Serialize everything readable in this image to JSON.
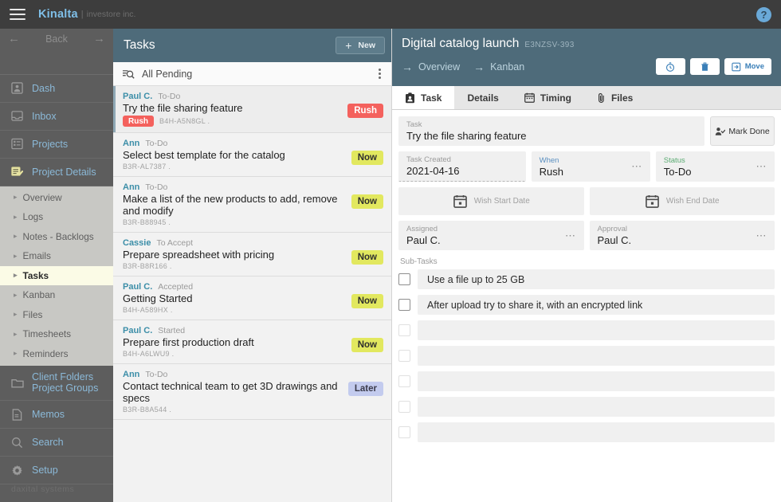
{
  "topbar": {
    "menu_icon": "hamburger-icon",
    "brand": "Kinalta",
    "separator": "|",
    "company": "investore inc.",
    "help_icon": "?"
  },
  "sidebar": {
    "back_label": "Back",
    "back_icon_left": "arrow-left-icon",
    "back_icon_right": "arrow-right-icon",
    "items": [
      {
        "label": "Dash",
        "icon": "dashboard-icon"
      },
      {
        "label": "Inbox",
        "icon": "inbox-icon"
      },
      {
        "label": "Projects",
        "icon": "projects-list-icon"
      },
      {
        "label": "Project Details",
        "icon": "project-details-icon"
      }
    ],
    "sub_items": [
      {
        "label": "Overview"
      },
      {
        "label": "Logs"
      },
      {
        "label": "Notes - Backlogs"
      },
      {
        "label": "Emails"
      },
      {
        "label": "Tasks"
      },
      {
        "label": "Kanban"
      },
      {
        "label": "Files"
      },
      {
        "label": "Timesheets"
      },
      {
        "label": "Reminders"
      }
    ],
    "selected_sub": "Tasks",
    "bottom_items": [
      {
        "label_line1": "Client Folders",
        "label_line2": "Project Groups",
        "icon": "folder-icon"
      },
      {
        "label_line1": "Memos",
        "label_line2": "",
        "icon": "document-icon"
      },
      {
        "label_line1": "Search",
        "label_line2": "",
        "icon": "search-icon"
      },
      {
        "label_line1": "Setup",
        "label_line2": "",
        "icon": "gear-icon"
      }
    ],
    "footer": "daxital systems"
  },
  "list_panel": {
    "title": "Tasks",
    "new_button": "New",
    "new_icon": "plus-icon",
    "filter_label": "All Pending",
    "filter_icon": "filter-search-icon",
    "menu_icon": "kebab-menu-icon",
    "tasks": [
      {
        "user": "Paul C.",
        "state": "To-Do",
        "title": "Try the file sharing feature",
        "inline_tag": "Rush",
        "id": "B4H-A5N8GL .",
        "badge": "Rush",
        "badge_kind": "rush",
        "selected": true
      },
      {
        "user": "Ann",
        "state": "To-Do",
        "title": "Select best template for the catalog",
        "inline_tag": "",
        "id": "B3R-AL7387 .",
        "badge": "Now",
        "badge_kind": "now",
        "selected": false
      },
      {
        "user": "Ann",
        "state": "To-Do",
        "title": "Make a list of the new products to add, remove and modify",
        "inline_tag": "",
        "id": "B3R-B88945 .",
        "badge": "Now",
        "badge_kind": "now",
        "selected": false
      },
      {
        "user": "Cassie",
        "state": "To Accept",
        "title": "Prepare spreadsheet with pricing",
        "inline_tag": "",
        "id": "B3R-B8R166 .",
        "badge": "Now",
        "badge_kind": "now",
        "selected": false
      },
      {
        "user": "Paul C.",
        "state": "Accepted",
        "title": "Getting Started",
        "inline_tag": "",
        "id": "B4H-A589HX .",
        "badge": "Now",
        "badge_kind": "now",
        "selected": false
      },
      {
        "user": "Paul C.",
        "state": "Started",
        "title": "Prepare first production draft",
        "inline_tag": "",
        "id": "B4H-A6LWU9 .",
        "badge": "Now",
        "badge_kind": "now",
        "selected": false
      },
      {
        "user": "Ann",
        "state": "To-Do",
        "title": "Contact technical team to get 3D drawings and specs",
        "inline_tag": "",
        "id": "B3R-B8A544 .",
        "badge": "Later",
        "badge_kind": "later",
        "selected": false
      }
    ]
  },
  "detail": {
    "project_title": "Digital catalog launch",
    "project_code": "E3NZSV-393",
    "links": [
      {
        "label": "Overview",
        "icon": "arrow-right-icon"
      },
      {
        "label": "Kanban",
        "icon": "arrow-right-icon"
      }
    ],
    "actions": [
      {
        "label": "",
        "icon": "timer-icon"
      },
      {
        "label": "",
        "icon": "trash-icon"
      },
      {
        "label": "Move",
        "icon": "move-icon"
      }
    ],
    "tabs": [
      {
        "label": "Task",
        "icon": "task-badge-icon",
        "active": true
      },
      {
        "label": "Details",
        "icon": "",
        "active": false
      },
      {
        "label": "Timing",
        "icon": "calendar-icon",
        "active": false
      },
      {
        "label": "Files",
        "icon": "paperclip-icon",
        "active": false
      }
    ],
    "mark_done": "Mark Done",
    "mark_done_icon": "person-check-icon",
    "fields": {
      "task_label": "Task",
      "task_value": "Try the file sharing feature",
      "created_label": "Task Created",
      "created_value": "2021-04-16",
      "when_label": "When",
      "when_value": "Rush",
      "status_label": "Status",
      "status_value": "To-Do",
      "wish_start_label": "Wish Start Date",
      "wish_start_value": "",
      "wish_end_label": "Wish End Date",
      "wish_end_value": "",
      "assigned_label": "Assigned",
      "assigned_value": "Paul C.",
      "approval_label": "Approval",
      "approval_value": "Paul C."
    },
    "subtasks_label": "Sub-Tasks",
    "subtasks": [
      {
        "text": "Use a file up to 25 GB",
        "checked": false,
        "empty": false
      },
      {
        "text": "After upload try to share it, with an encrypted link",
        "checked": false,
        "empty": false
      },
      {
        "text": "",
        "checked": false,
        "empty": true
      },
      {
        "text": "",
        "checked": false,
        "empty": true
      },
      {
        "text": "",
        "checked": false,
        "empty": true
      },
      {
        "text": "",
        "checked": false,
        "empty": true
      },
      {
        "text": "",
        "checked": false,
        "empty": true
      }
    ]
  },
  "colors": {
    "topbar": "#3d3d3d",
    "sidebar": "#5d5d5d",
    "panel_header": "#4e6b7a",
    "accent_link": "#8bb9d8",
    "badge_rush": "#f4615d",
    "badge_now": "#e2e85f",
    "badge_later": "#c3cbee",
    "selected_sub": "#fbfbe6"
  }
}
